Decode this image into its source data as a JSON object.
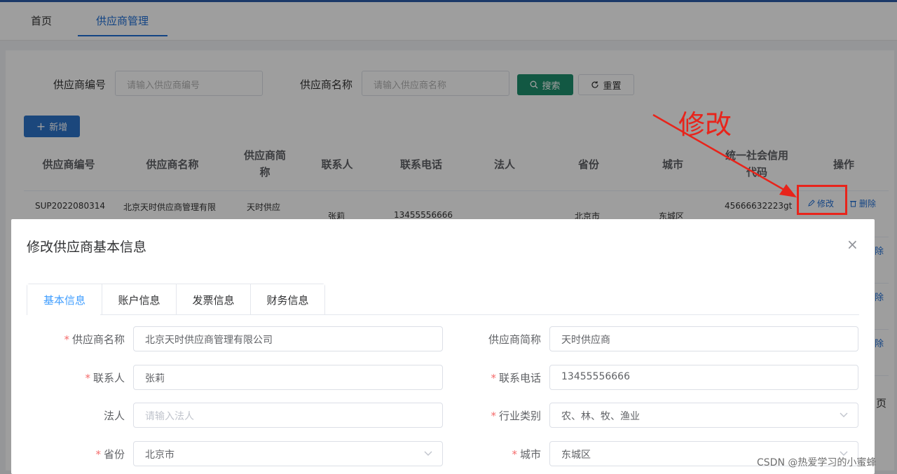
{
  "top_tabs": [
    "首页",
    "供应商管理"
  ],
  "search": {
    "code_label": "供应商编号",
    "code_placeholder": "请输入供应商编号",
    "name_label": "供应商名称",
    "name_placeholder": "请输入供应商名称",
    "search_button": "搜索",
    "reset_button": "重置",
    "add_button": "新增"
  },
  "table": {
    "headers": [
      "供应商编号",
      "供应商名称",
      "供应商简称",
      "联系人",
      "联系电话",
      "法人",
      "省份",
      "城市",
      "统一社会信用代码",
      "操作"
    ],
    "row": {
      "code": "SUP2022080314",
      "name": "北京天时供应商管理有限",
      "short_name": "天时供应",
      "contact": "张莉",
      "phone": "13455556666",
      "province": "北京市",
      "city": "东城区",
      "credit_code": "45666632223gt",
      "edit": "修改",
      "delete": "删除"
    },
    "partial_delete": "除",
    "pager_fragment": "页"
  },
  "annotation": {
    "text": "修改",
    "color": "#e8241b"
  },
  "dialog": {
    "title": "修改供应商基本信息",
    "close": "×",
    "tabs": [
      "基本信息",
      "账户信息",
      "发票信息",
      "财务信息"
    ],
    "form": {
      "supplier_name_label": "供应商名称",
      "supplier_name_value": "北京天时供应商管理有限公司",
      "short_name_label": "供应商简称",
      "short_name_value": "天时供应商",
      "contact_label": "联系人",
      "contact_value": "张莉",
      "phone_label": "联系电话",
      "phone_value": "13455556666",
      "legal_label": "法人",
      "legal_placeholder": "请输入法人",
      "industry_label": "行业类别",
      "industry_value": "农、林、牧、渔业",
      "province_label": "省份",
      "province_value": "北京市",
      "city_label": "城市",
      "city_value": "东城区"
    }
  },
  "watermark": "CSDN @热爱学习的小蜜蜂",
  "colors": {
    "primary": "#1f6fd6",
    "search_green": "#1e8f6d",
    "required": "#f56c6c"
  }
}
